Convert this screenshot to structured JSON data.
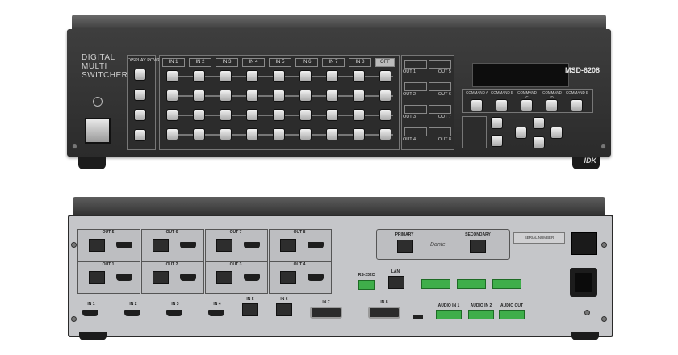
{
  "front": {
    "brand_line1": "DIGITAL",
    "brand_line2": "MULTI",
    "brand_line3": "SWITCHER",
    "model": "MSD-6208",
    "maker": "IDK",
    "display_power": "DISPLAY POWER",
    "inputs": [
      "IN 1",
      "IN 2",
      "IN 3",
      "IN 4",
      "IN 5",
      "IN 6",
      "IN 7",
      "IN 8"
    ],
    "off": "OFF",
    "out_rows": [
      [
        "OUT 1",
        "OUT 5"
      ],
      [
        "OUT 2",
        "OUT 6"
      ],
      [
        "OUT 3",
        "OUT 7"
      ],
      [
        "OUT 4",
        "OUT 8"
      ]
    ],
    "commands": [
      "COMMAND A",
      "COMMAND B",
      "COMMAND C",
      "COMMAND D",
      "COMMAND E"
    ]
  },
  "rear": {
    "top_groups": [
      "OUT 5",
      "OUT 6",
      "OUT 7",
      "OUT 8"
    ],
    "mid_groups": [
      "OUT 1",
      "OUT 2",
      "OUT 3",
      "OUT 4"
    ],
    "bottom_inputs": [
      "IN 1",
      "IN 2",
      "IN 3",
      "IN 4"
    ],
    "hdbt_inputs": [
      "IN 5",
      "IN 6"
    ],
    "dvi_inputs": [
      "IN 7",
      "IN 8"
    ],
    "primary": "PRIMARY",
    "secondary": "SECONDARY",
    "dante": "Dante",
    "serial_number": "SERIAL NUMBER",
    "rs232c": "RS-232C",
    "lan": "LAN",
    "audio_in1": "AUDIO IN 1",
    "audio_in2": "AUDIO IN 2",
    "audio_out": "AUDIO OUT"
  }
}
